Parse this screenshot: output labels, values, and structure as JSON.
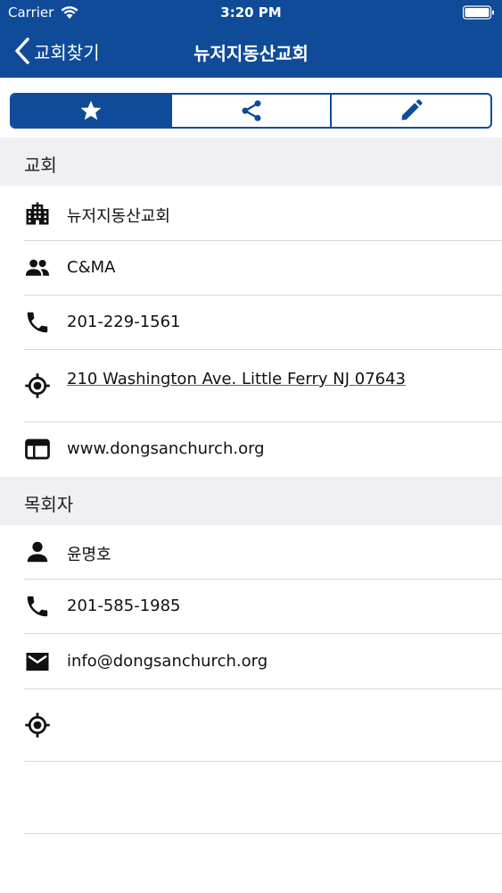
{
  "status_bar": {
    "carrier": "Carrier",
    "time": "3:20 PM"
  },
  "nav": {
    "back_label": "교회찾기",
    "title": "뉴저지동산교회"
  },
  "segments": [
    {
      "icon": "star-icon",
      "active": true
    },
    {
      "icon": "share-icon",
      "active": false
    },
    {
      "icon": "pencil-icon",
      "active": false
    }
  ],
  "church_section": {
    "title": "교회",
    "name": "뉴저지동산교회",
    "denomination": "C&MA",
    "phone": "201-229-1561",
    "address": "210 Washington Ave. Little Ferry NJ 07643",
    "website": "www.dongsanchurch.org"
  },
  "pastor_section": {
    "title": "목회자",
    "name": "윤명호",
    "phone": "201-585-1985",
    "email": "info@dongsanchurch.org",
    "location": ""
  },
  "colors": {
    "primary": "#0f4b99",
    "section_bg": "#efeff4",
    "divider": "#d8d8dc"
  }
}
